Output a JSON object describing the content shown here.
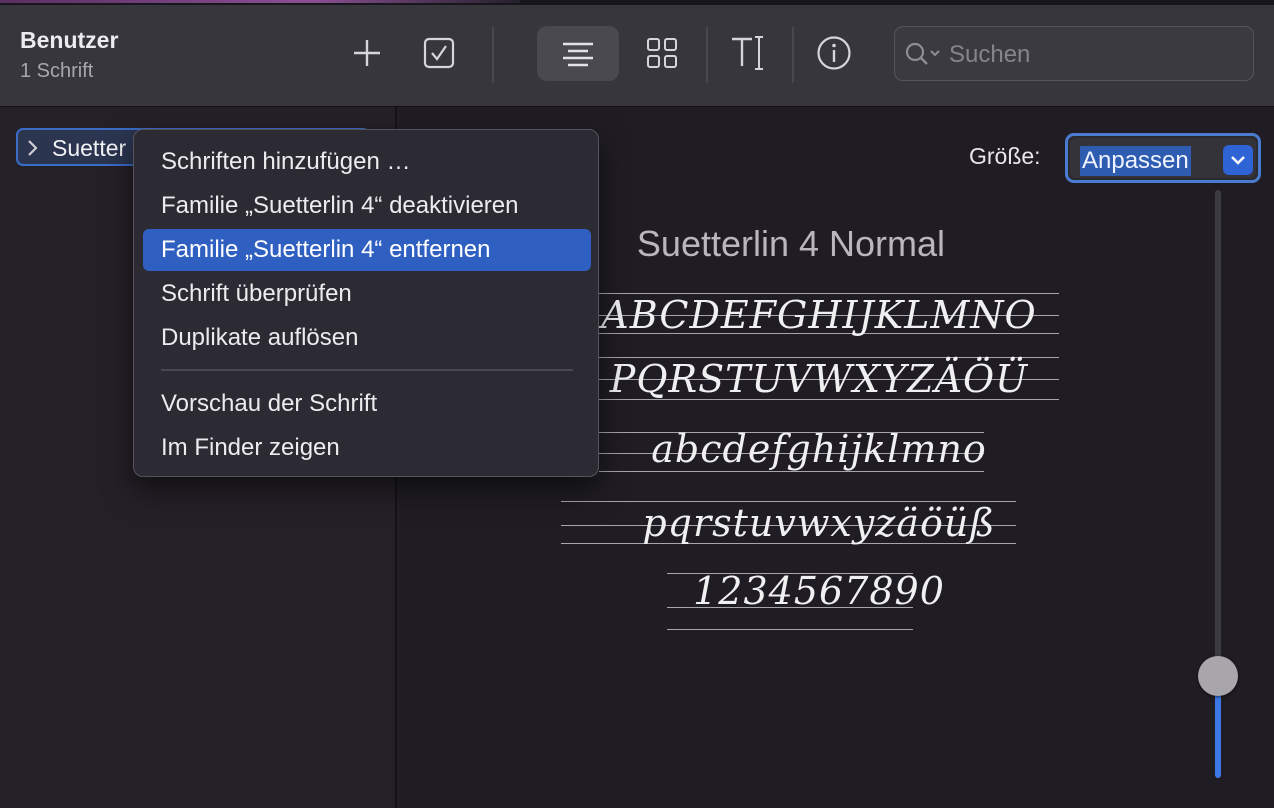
{
  "window": {
    "title": "Benutzer",
    "subtitle": "1 Schrift"
  },
  "toolbar": {
    "buttons": [
      {
        "name": "add-icon"
      },
      {
        "name": "checkbox-icon"
      },
      {
        "name": "list-view-icon",
        "active": true
      },
      {
        "name": "grid-view-icon"
      },
      {
        "name": "text-cursor-icon"
      },
      {
        "name": "info-icon"
      }
    ],
    "search_placeholder": "Suchen"
  },
  "sidebar": {
    "items": [
      {
        "label": "Suetter",
        "selected": true
      }
    ]
  },
  "preview": {
    "size_label": "Größe:",
    "size_value": "Anpassen",
    "font_name": "Suetterlin 4 Normal",
    "specimen_lines": [
      "ABCDEFGHIJKLMNO",
      "PQRSTUVWXYZÄÖÜ",
      "abcdefghijklmno",
      "pqrstuvwxyzäöüß",
      "1234567890"
    ],
    "slider_level": 0.17
  },
  "context_menu": {
    "items": [
      {
        "label": "Schriften hinzufügen …"
      },
      {
        "label": "Familie „Suetterlin 4“ deaktivieren"
      },
      {
        "label": "Familie „Suetterlin 4“ entfernen",
        "highlighted": true
      },
      {
        "label": "Schrift überprüfen"
      },
      {
        "label": "Duplikate auflösen"
      },
      {
        "label": "Vorschau der Schrift"
      },
      {
        "label": "Im Finder zeigen"
      }
    ]
  },
  "colors": {
    "accent": "#2f5fc1",
    "selection_border": "#3b6cc8",
    "slider_fill": "#3c79e6"
  }
}
